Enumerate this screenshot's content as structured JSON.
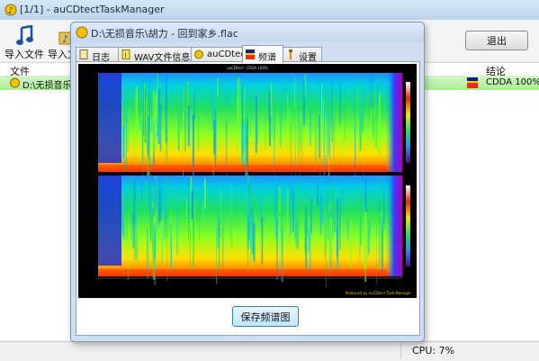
{
  "window": {
    "title": "[1/1] - auCDtectTaskManager",
    "toolbar": {
      "import_file": "导入文件",
      "import_folder": "导入文",
      "exit": "退出"
    },
    "list": {
      "col_file": "文件",
      "col_conclusion": "结论",
      "row_file": "D:\\无损音乐\\",
      "row_conclusion": "CDDA 100%"
    },
    "status": {
      "cpu": "CPU: 7%"
    }
  },
  "dialog": {
    "title": "D:\\无损音乐\\胡力 - 回到家乡.flac",
    "tabs": [
      {
        "label": "日志",
        "icon": "log-icon"
      },
      {
        "label": "WAV文件信息",
        "icon": "info-icon"
      },
      {
        "label": "auCDtect",
        "icon": "aucdtect-icon"
      },
      {
        "label": "频谱",
        "icon": "spectrum-icon"
      },
      {
        "label": "设置",
        "icon": "settings-icon"
      }
    ],
    "active_tab": "频谱",
    "spectrogram": {
      "header_text": "auCDtect: CDDA 100%",
      "footer_text": "Produced by auCDtect Task Manager"
    },
    "save_button": "保存频谱图"
  },
  "colors": {
    "row_highlight": "#a9ed94",
    "spectrum_high": "#ff1a00",
    "spectrum_mid": "#ffe000",
    "spectrum_low": "#00a0ff",
    "spectrum_bg": "#000000"
  }
}
